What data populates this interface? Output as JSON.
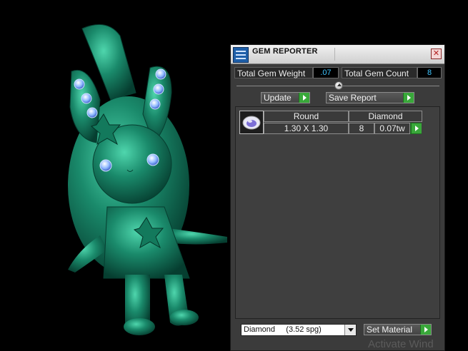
{
  "panel": {
    "title": "GEM REPORTER",
    "close_glyph": "✕",
    "total_gem_weight_label": "Total Gem Weight",
    "total_gem_weight_value": ".07",
    "total_gem_count_label": "Total Gem Count",
    "total_gem_count_value": "8",
    "update_label": "Update",
    "save_report_label": "Save Report"
  },
  "gem_list": {
    "shape": "Round",
    "material": "Diamond",
    "size": "1.30 X 1.30",
    "count": "8",
    "weight": "0.07tw"
  },
  "footer": {
    "material_selected": "Diamond     (3.52 spg)",
    "set_material_label": "Set Material"
  },
  "watermark_text": "Activate Wind",
  "colors": {
    "model_green": "#1a8a6b",
    "gem_blue": "#8fb8ff",
    "value_text": "#3fc4ff",
    "play_green": "#39a83a"
  }
}
